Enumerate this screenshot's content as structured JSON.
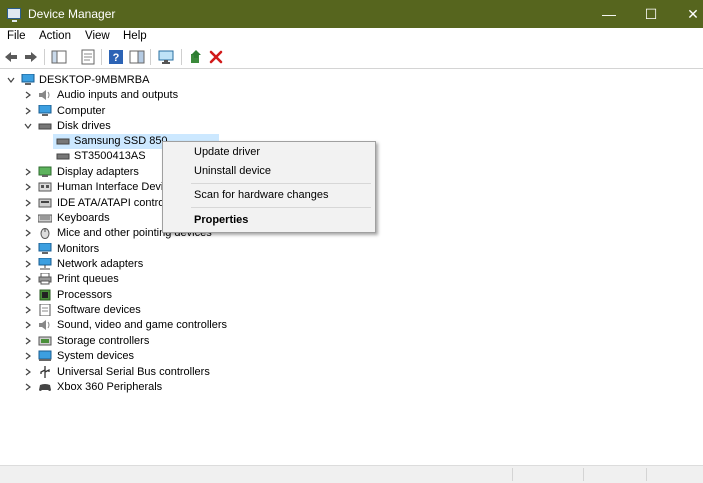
{
  "window": {
    "title": "Device Manager",
    "minimize": "—",
    "maximize": "☐",
    "close": "✕"
  },
  "menu": [
    "File",
    "Action",
    "View",
    "Help"
  ],
  "tree": {
    "root": "DESKTOP-9MBMRBA",
    "categories": [
      "Audio inputs and outputs",
      "Computer",
      "Disk drives",
      "Display adapters",
      "Human Interface Devi",
      "IDE ATA/ATAPI contro",
      "Keyboards",
      "Mice and other pointing devices",
      "Monitors",
      "Network adapters",
      "Print queues",
      "Processors",
      "Software devices",
      "Sound, video and game controllers",
      "Storage controllers",
      "System devices",
      "Universal Serial Bus controllers",
      "Xbox 360 Peripherals"
    ],
    "disk_children": [
      "Samsung SSD 850",
      "ST3500413AS"
    ]
  },
  "context_menu": {
    "items": [
      "Update driver",
      "Uninstall device",
      "Scan for hardware changes",
      "Properties"
    ]
  }
}
